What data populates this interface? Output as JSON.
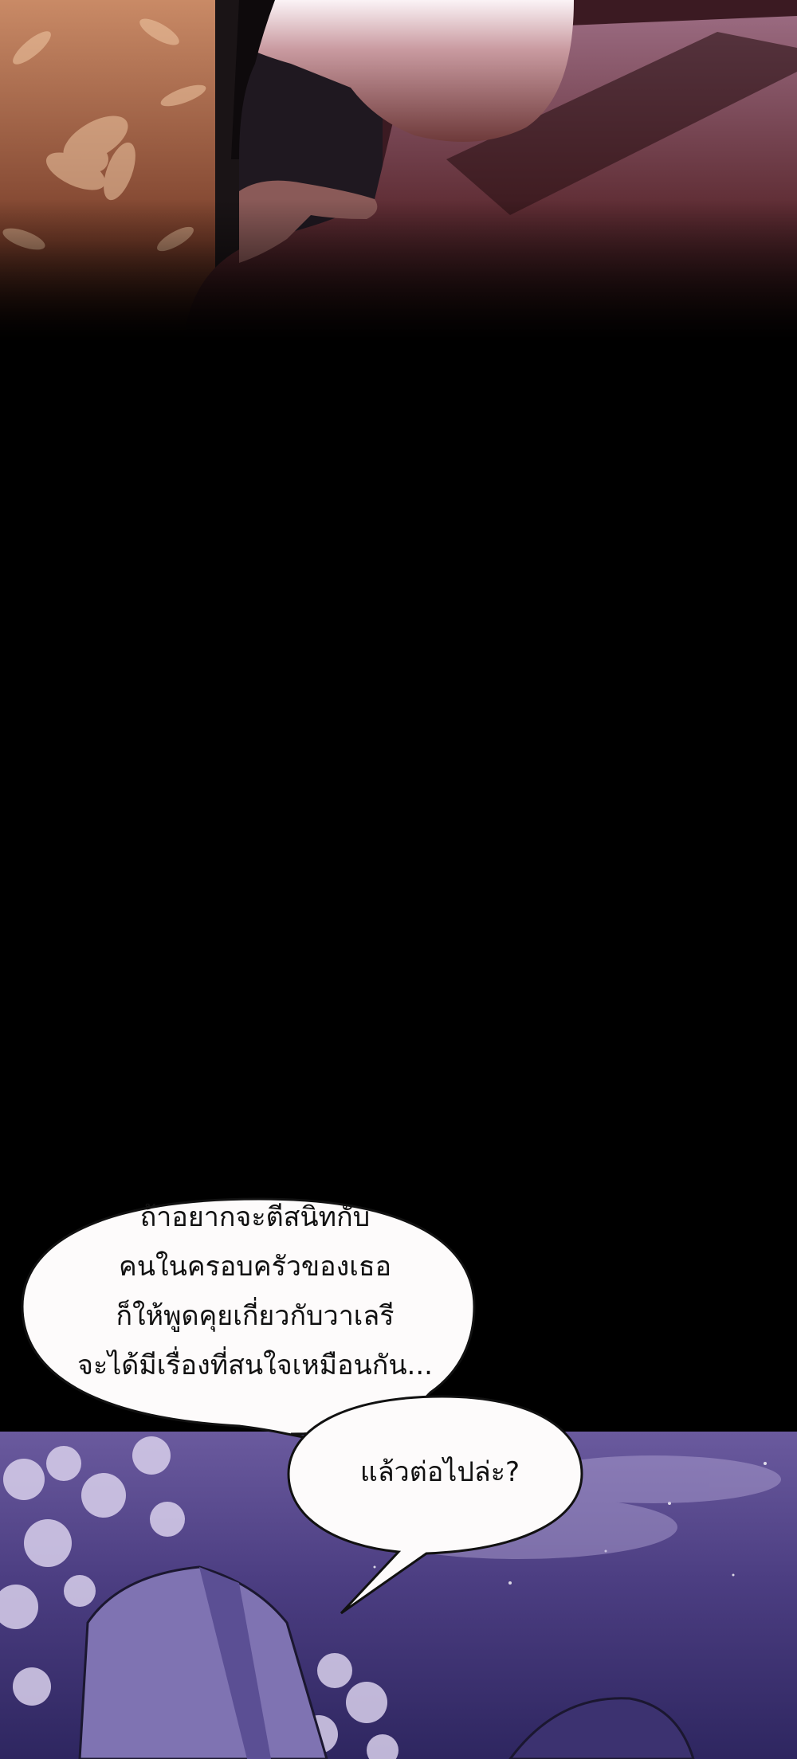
{
  "bubble_1": {
    "lines": [
      "ถ้าอยากจะตีสนิทกับ",
      "คนในครอบครัวของเธอ",
      "ก็ให้พูดคุยเกี่ยวกับวาเลรี",
      "จะได้มีเรื่องที่สนใจเหมือนกัน..."
    ]
  },
  "bubble_2": {
    "text": "แล้วต่อไปล่ะ?"
  }
}
